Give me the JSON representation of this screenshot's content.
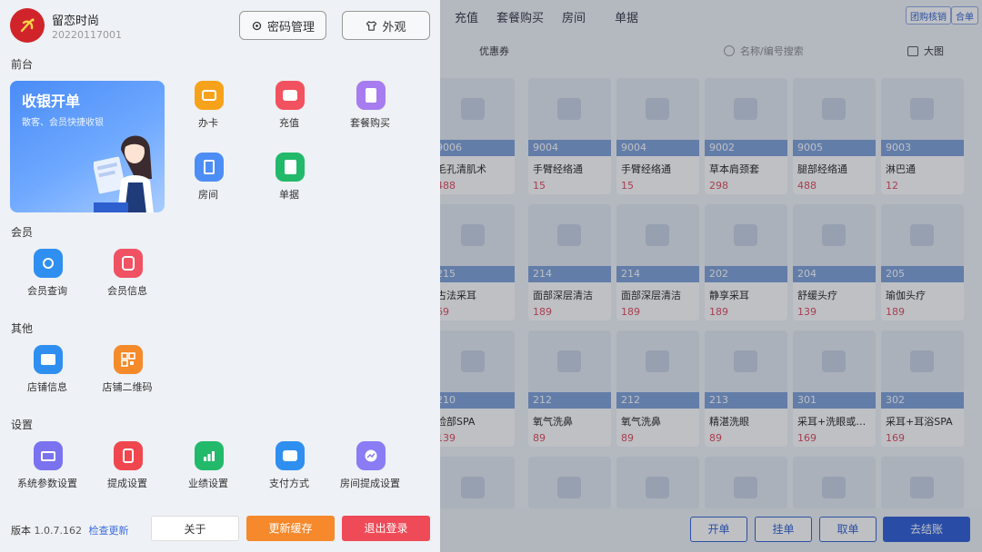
{
  "background": {
    "tabs": [
      "充值",
      "套餐购买",
      "房间",
      "单据"
    ],
    "top_buttons": [
      "团购核销",
      "合单"
    ],
    "coupon_label": "优惠券",
    "search_placeholder": "名称/编号搜索",
    "big_image_label": "大图",
    "products": [
      {
        "code": "9006",
        "name": "毛孔清肌术",
        "price": "488"
      },
      {
        "code": "9004",
        "name": "手臂经络通",
        "price": "15"
      },
      {
        "code": "9004",
        "name": "手臂经络通",
        "price": "15"
      },
      {
        "code": "9002",
        "name": "草本肩颈套",
        "price": "298"
      },
      {
        "code": "9005",
        "name": "腿部经络通",
        "price": "488"
      },
      {
        "code": "9003",
        "name": "淋巴通",
        "price": "12"
      },
      {
        "code": "215",
        "name": "古法采耳",
        "price": "69"
      },
      {
        "code": "214",
        "name": "面部深层清洁",
        "price": "189"
      },
      {
        "code": "214",
        "name": "面部深层清洁",
        "price": "189"
      },
      {
        "code": "202",
        "name": "静享采耳",
        "price": "189"
      },
      {
        "code": "204",
        "name": "舒缓头疗",
        "price": "139"
      },
      {
        "code": "205",
        "name": "瑜伽头疗",
        "price": "189"
      },
      {
        "code": "210",
        "name": "脸部SPA",
        "price": "139"
      },
      {
        "code": "212",
        "name": "氧气洗鼻",
        "price": "89"
      },
      {
        "code": "212",
        "name": "氧气洗鼻",
        "price": "89"
      },
      {
        "code": "213",
        "name": "精湛洗眼",
        "price": "89"
      },
      {
        "code": "301",
        "name": "采耳+洗眼或…",
        "price": "169"
      },
      {
        "code": "302",
        "name": "采耳+耳浴SPA",
        "price": "169"
      }
    ],
    "bottom_buttons": [
      "开单",
      "挂单",
      "取单",
      "去结账"
    ]
  },
  "drawer": {
    "shop_name": "留恋时尚",
    "shop_id": "20220117001",
    "password_button": "密码管理",
    "appearance_button": "外观",
    "sections": {
      "front": "前台",
      "member": "会员",
      "other": "其他",
      "settings": "设置"
    },
    "hero": {
      "title": "收银开单",
      "subtitle": "散客、会员快捷收银"
    },
    "front_items": [
      {
        "label": "办卡",
        "color": "#f7a21b"
      },
      {
        "label": "充值",
        "color": "#f2525f"
      },
      {
        "label": "套餐购买",
        "color": "#a77cf0"
      },
      {
        "label": "房间",
        "color": "#4d8df6"
      },
      {
        "label": "单据",
        "color": "#22b96a"
      }
    ],
    "member_items": [
      {
        "label": "会员查询",
        "color": "#2f8ff0"
      },
      {
        "label": "会员信息",
        "color": "#f05263"
      }
    ],
    "other_items": [
      {
        "label": "店铺信息",
        "color": "#2f8ff0"
      },
      {
        "label": "店铺二维码",
        "color": "#f58a2a"
      }
    ],
    "settings_items": [
      {
        "label": "系统参数设置",
        "color": "#7b72f0"
      },
      {
        "label": "提成设置",
        "color": "#f0474f"
      },
      {
        "label": "业绩设置",
        "color": "#22b96a"
      },
      {
        "label": "支付方式",
        "color": "#2f8ff0"
      },
      {
        "label": "房间提成设置",
        "color": "#8a7cf5"
      }
    ],
    "footer": {
      "version_label": "版本",
      "version": "1.0.7.162",
      "check_update": "检查更新",
      "about": "关于",
      "refresh_cache": "更新缓存",
      "logout": "退出登录"
    }
  }
}
